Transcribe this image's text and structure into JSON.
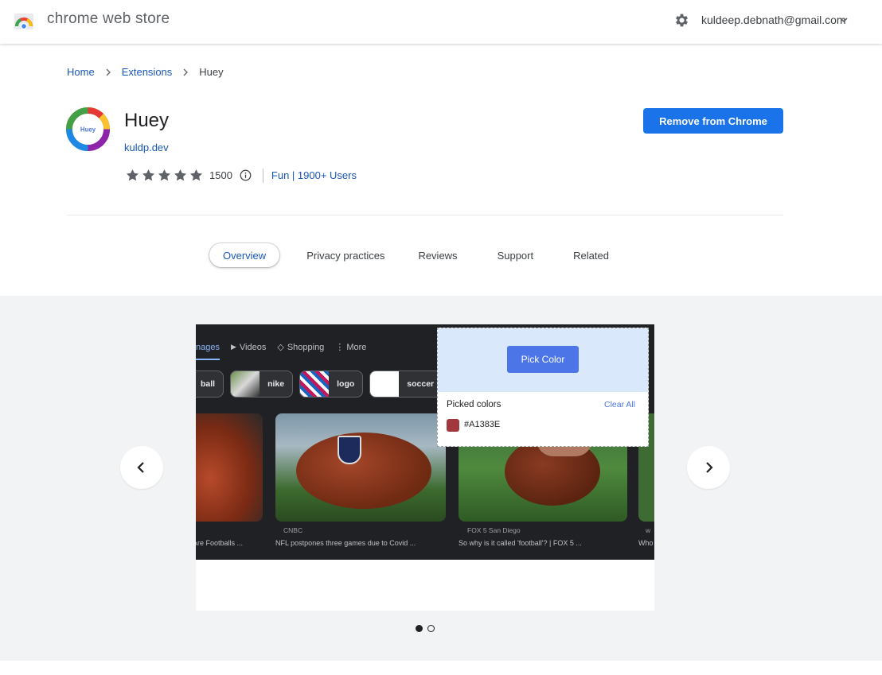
{
  "app": {
    "title": "chrome web store",
    "account": "kuldeep.debnath@gmail.com"
  },
  "breadcrumb": {
    "home": "Home",
    "extensions": "Extensions",
    "current": "Huey"
  },
  "extension": {
    "icon_text": "Huey",
    "name": "Huey",
    "developer": "kuldp.dev",
    "rating": 5,
    "rating_count": "1500",
    "category": "Fun | 1900+ Users",
    "action_label": "Remove from Chrome"
  },
  "tabs": [
    "Overview",
    "Privacy practices",
    "Reviews",
    "Support",
    "Related"
  ],
  "active_tab": "Overview",
  "gallery": {
    "slide_index": 1,
    "slide_count": 2,
    "screenshot": {
      "search_tabs": [
        "nages",
        "Videos",
        "Shopping",
        "More"
      ],
      "chips": [
        "ball",
        "nike",
        "logo",
        "soccer"
      ],
      "cards": [
        {
          "source": "",
          "caption": "Are Footballs ..."
        },
        {
          "source": "CNBC",
          "caption": "NFL postpones three games due to Covid ..."
        },
        {
          "source": "FOX 5 San Diego",
          "caption": "So why is it called 'football'? | FOX 5 ..."
        },
        {
          "source": "w",
          "caption": "Who"
        }
      ],
      "picker": {
        "button": "Pick Color",
        "picked_title": "Picked colors",
        "clear_all": "Clear All",
        "color_hex": "#A1383E"
      }
    }
  },
  "colors": {
    "accent": "#1a73e8",
    "link": "#1a57b8",
    "picked": "#A1383E"
  }
}
